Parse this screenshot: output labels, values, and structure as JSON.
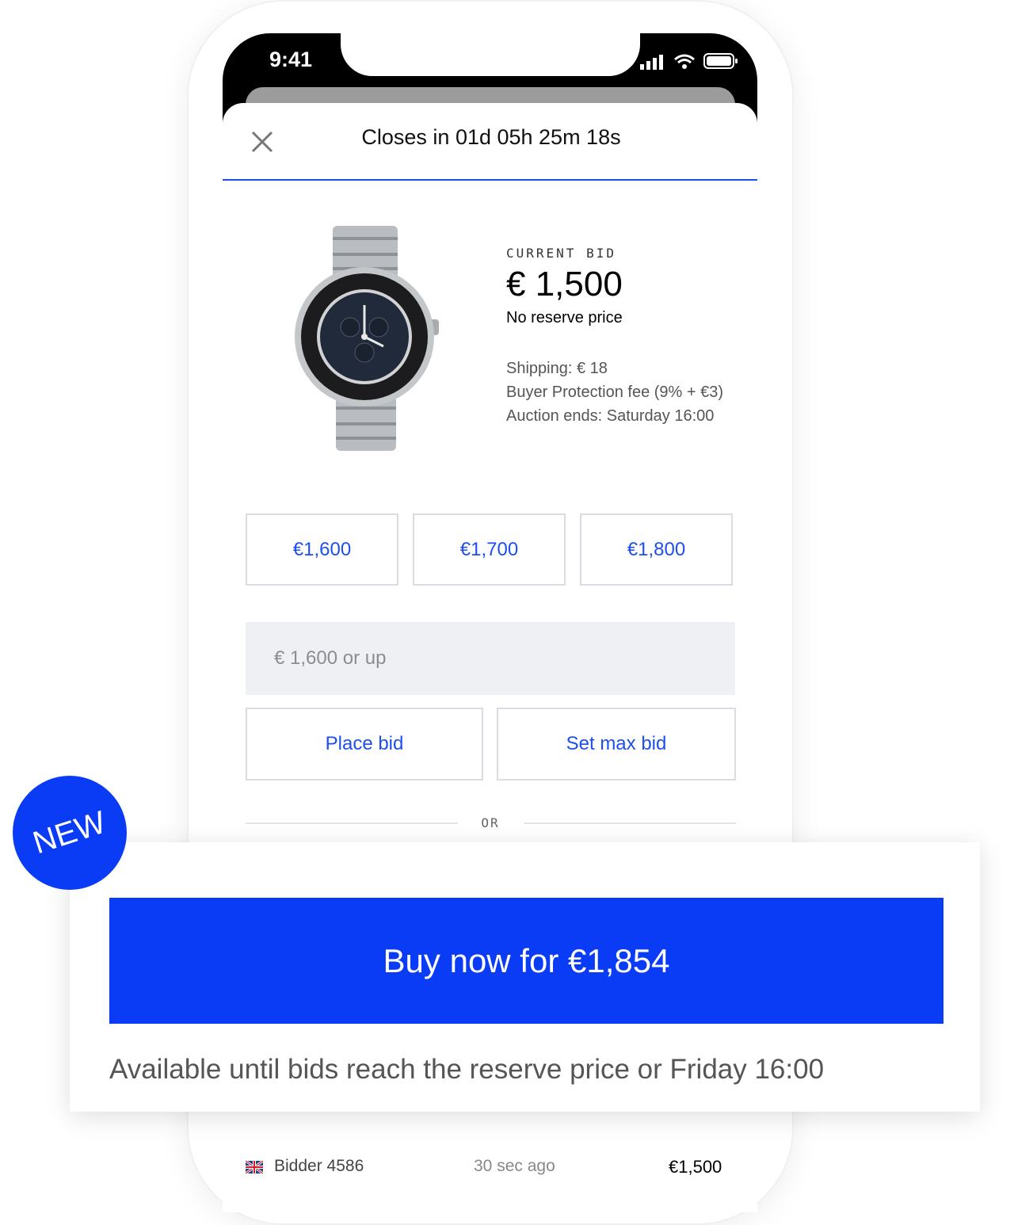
{
  "status_bar": {
    "time": "9:41"
  },
  "header": {
    "countdown": "Closes in 01d 05h 25m 18s"
  },
  "item": {
    "current_bid_label": "CURRENT BID",
    "current_bid": "€ 1,500",
    "reserve": "No reserve price",
    "shipping": "Shipping: € 18",
    "protection": "Buyer Protection fee (9% + €3)",
    "auction_ends": "Auction ends: Saturday 16:00"
  },
  "quick_bids": [
    "€1,600",
    "€1,700",
    "€1,800"
  ],
  "bid_input": {
    "placeholder": "€ 1,600 or up"
  },
  "actions": {
    "place_bid": "Place bid",
    "set_max_bid": "Set max bid",
    "or": "OR"
  },
  "callout": {
    "badge": "NEW",
    "buy_now": "Buy now for €1,854",
    "availability": "Available until bids reach the reserve price or Friday 16:00"
  },
  "bid_history": [
    {
      "bidder": "Bidder 4586",
      "time": "30 sec ago",
      "amount": "€1,500",
      "flag": "uk-flag-icon"
    }
  ],
  "colors": {
    "accent": "#0a3cf5",
    "link": "#1d4ef0"
  }
}
